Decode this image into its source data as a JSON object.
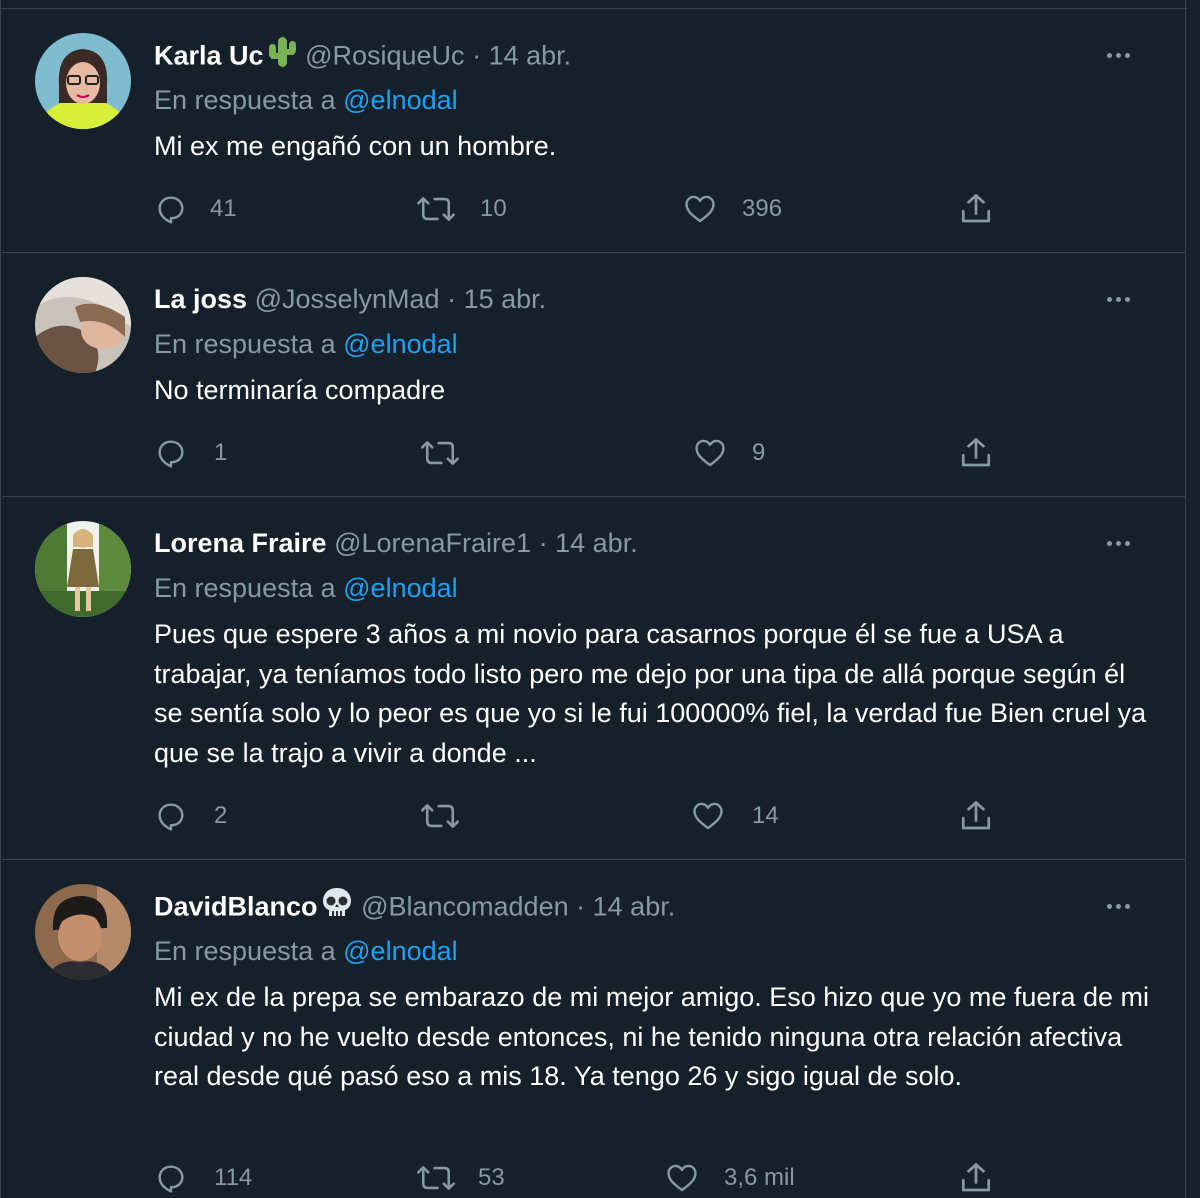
{
  "tweets": [
    {
      "name": "Karla Uc",
      "emoji": "cactus-icon",
      "handle": "@RosiqueUc",
      "dot": "·",
      "date": "14 abr.",
      "reply_prefix": "En respuesta a",
      "mention": "@elnodal",
      "text": "Mi ex me engañó con un hombre.",
      "replies": "41",
      "retweets": "10",
      "likes": "396"
    },
    {
      "name": "La joss",
      "handle": "@JosselynMad",
      "dot": "·",
      "date": "15 abr.",
      "reply_prefix": "En respuesta a",
      "mention": "@elnodal",
      "text": "No terminaría compadre",
      "replies": "1",
      "retweets": "",
      "likes": "9"
    },
    {
      "name": "Lorena Fraire",
      "handle": "@LorenaFraire1",
      "dot": "·",
      "date": "14 abr.",
      "reply_prefix": "En respuesta a",
      "mention": "@elnodal",
      "text": "Pues que espere 3 años a mi novio para casarnos porque él se fue a USA a trabajar, ya teníamos todo listo pero me dejo por una tipa de allá porque según él se sentía solo y lo peor es que yo si le fui 100000% fiel, la verdad fue Bien cruel ya que se la trajo a vivir a donde ...",
      "replies": "2",
      "retweets": "",
      "likes": "14"
    },
    {
      "name": "DavidBlanco",
      "emoji": "skull-icon",
      "handle": "@Blancomadden",
      "dot": "·",
      "date": "14 abr.",
      "reply_prefix": "En respuesta a",
      "mention": "@elnodal",
      "text": "Mi ex de la prepa se embarazo de mi mejor amigo. Eso hizo que yo me fuera de mi ciudad y no he vuelto desde entonces, ni he tenido ninguna otra relación afectiva real desde qué pasó eso a mis 18. Ya tengo 26 y sigo igual de solo.",
      "replies": "114",
      "retweets": "53",
      "likes": "3,6 mil"
    }
  ],
  "colors": {
    "background": "#15202b",
    "border": "#38444d",
    "secondary_text": "#8899a6",
    "link": "#1da1f2"
  }
}
